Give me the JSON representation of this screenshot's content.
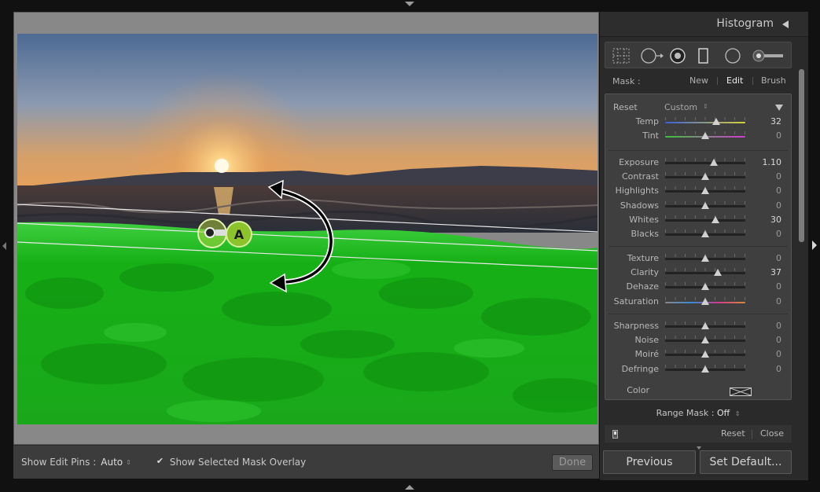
{
  "toolbar": {
    "show_edit_pins_label": "Show Edit Pins :",
    "show_edit_pins_value": "Auto",
    "mask_overlay_label": "Show Selected Mask Overlay",
    "mask_overlay_checked": true,
    "done_label": "Done"
  },
  "panel": {
    "histogram_title": "Histogram",
    "tools": [
      "crop-overlay-icon",
      "spot-removal-icon",
      "red-eye-icon",
      "graduated-filter-icon",
      "radial-filter-icon",
      "adjustment-brush-icon"
    ],
    "mask": {
      "label": "Mask :",
      "new": "New",
      "edit": "Edit",
      "brush": "Brush",
      "selected": "Edit"
    },
    "effect": {
      "reset_label": "Reset",
      "preset": "Custom"
    },
    "groups": [
      [
        {
          "label": "Temp",
          "value": "32",
          "pos": 0.64,
          "colors": [
            "#3b5fd6",
            "#d8d23a"
          ]
        },
        {
          "label": "Tint",
          "value": "0",
          "pos": 0.5,
          "colors": [
            "#3ec13e",
            "#d23ad2"
          ]
        }
      ],
      [
        {
          "label": "Exposure",
          "value": "1.10",
          "pos": 0.61
        },
        {
          "label": "Contrast",
          "value": "0",
          "pos": 0.5
        },
        {
          "label": "Highlights",
          "value": "0",
          "pos": 0.5
        },
        {
          "label": "Shadows",
          "value": "0",
          "pos": 0.5
        },
        {
          "label": "Whites",
          "value": "30",
          "pos": 0.63
        },
        {
          "label": "Blacks",
          "value": "0",
          "pos": 0.5
        }
      ],
      [
        {
          "label": "Texture",
          "value": "0",
          "pos": 0.5
        },
        {
          "label": "Clarity",
          "value": "37",
          "pos": 0.66
        },
        {
          "label": "Dehaze",
          "value": "0",
          "pos": 0.5
        },
        {
          "label": "Saturation",
          "value": "0",
          "pos": 0.5,
          "colors": [
            "#888888",
            "#3a8ad6",
            "#d23a8a",
            "#d88a3a"
          ]
        }
      ],
      [
        {
          "label": "Sharpness",
          "value": "0",
          "pos": 0.5
        },
        {
          "label": "Noise",
          "value": "0",
          "pos": 0.5
        },
        {
          "label": "Moiré",
          "value": "0",
          "pos": 0.5
        },
        {
          "label": "Defringe",
          "value": "0",
          "pos": 0.5
        }
      ]
    ],
    "color_label": "Color",
    "range_mask_label": "Range Mask :",
    "range_mask_value": "Off",
    "reset_button": "Reset",
    "close_button": "Close",
    "previous_button": "Previous",
    "set_default_button": "Set Default..."
  },
  "canvas": {
    "pin_label": "A",
    "mask_color": "#1db01d"
  }
}
